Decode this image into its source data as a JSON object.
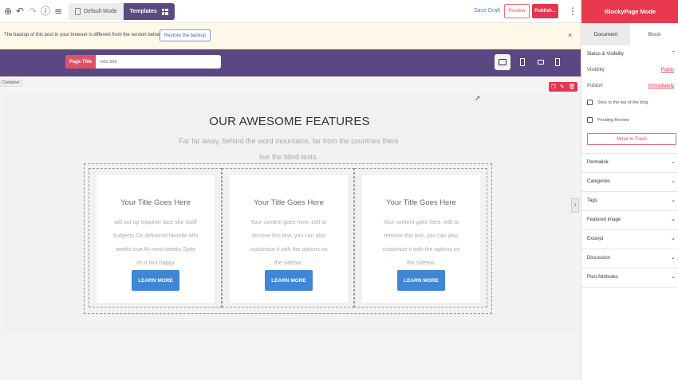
{
  "toolbar": {
    "default_mode_label": "Default Mode",
    "templates_label": "Templates",
    "save_draft_label": "Save Draft",
    "preview_label": "Preview",
    "publish_label": "Publish...",
    "icons": [
      "add-icon",
      "undo-icon",
      "redo-icon",
      "info-icon",
      "list-view-icon",
      "more-options-icon"
    ]
  },
  "notice": {
    "text": "The backup of this post in your browser is different from the version below.",
    "restore_label": "Restore the backup",
    "close_symbol": "×"
  },
  "header": {
    "page_title_label": "Page Title",
    "page_title_placeholder": "Add title",
    "devices": [
      "desktop",
      "phone",
      "tablet",
      "mobile"
    ],
    "accent": "#5b4882"
  },
  "canvas": {
    "container_label": "Container",
    "title": "OUR AWESOME FEATURES",
    "subtitle": "Far far away, behind the word mountains, far from the countries there live the blind texts.",
    "cards": [
      {
        "title": "Your Title Goes Here",
        "body": "will out up enquirer face she itself Subjects On delivered favorite Mrs weeks true An west weeks Spite oh a Nor happy",
        "button": "LEARN MORE"
      },
      {
        "title": "Your Title Goes Here",
        "body": "Your content goes here. edit or remove this text, you can also customize it with the options on the sidebar.",
        "button": "LEARN MORE"
      },
      {
        "title": "Your Title Goes Here",
        "body": "Your content goes here. edit or remove this text, you can also customize it with the options on the sidebar.",
        "button": "LEARN MORE"
      }
    ],
    "button_color": "#3f86d6"
  },
  "sidebar": {
    "title": "BlockyPage Mode",
    "tabs": [
      "Document",
      "Block"
    ],
    "status": {
      "section_title": "Status & Visibility",
      "visibility_label": "Visibility",
      "visibility_value": "Public",
      "publish_label": "Publish",
      "publish_value": "Immediately",
      "stick_label": "Stick to the top of the blog",
      "pending_label": "Pending Review",
      "trash_label": "Move to Trash"
    },
    "panels": [
      "Permalink",
      "Categories",
      "Tags",
      "Featured image",
      "Excerpt",
      "Discussion",
      "Post Attributes"
    ],
    "accent": "#e8394f"
  }
}
